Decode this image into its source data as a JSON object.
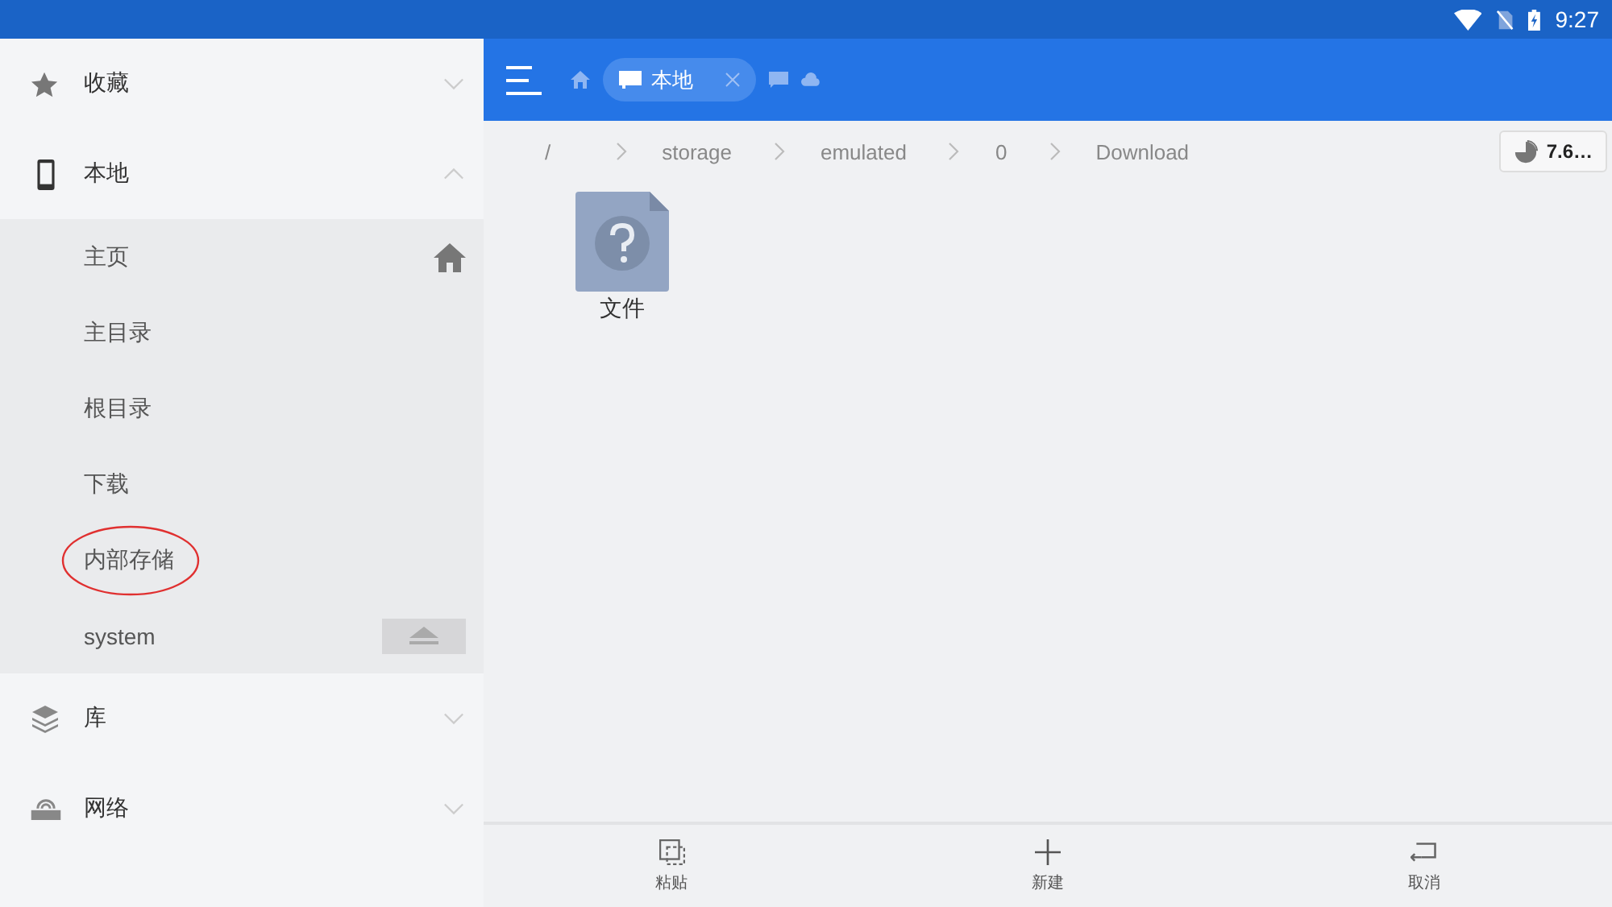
{
  "status_bar": {
    "time": "9:27"
  },
  "sidebar": {
    "sections": [
      {
        "label": "收藏",
        "expanded": false
      },
      {
        "label": "本地",
        "expanded": true,
        "children": [
          {
            "label": "主页",
            "kind": "home",
            "circled": false
          },
          {
            "label": "主目录",
            "kind": "plain",
            "circled": false
          },
          {
            "label": "根目录",
            "kind": "plain",
            "circled": false
          },
          {
            "label": "下载",
            "kind": "plain",
            "circled": false
          },
          {
            "label": "内部存储",
            "kind": "plain",
            "circled": true
          },
          {
            "label": "system",
            "kind": "eject",
            "circled": false
          }
        ]
      },
      {
        "label": "库",
        "expanded": false
      },
      {
        "label": "网络",
        "expanded": false
      }
    ]
  },
  "toolbar": {
    "tabs": [
      {
        "label": "本地",
        "selected": true
      }
    ]
  },
  "breadcrumbs": [
    "/",
    "storage",
    "emulated",
    "0",
    "Download"
  ],
  "storage_badge": "7.6…",
  "files": [
    {
      "name": "文件"
    }
  ],
  "bottom_actions": [
    {
      "label": "粘贴"
    },
    {
      "label": "新建"
    },
    {
      "label": "取消"
    }
  ]
}
